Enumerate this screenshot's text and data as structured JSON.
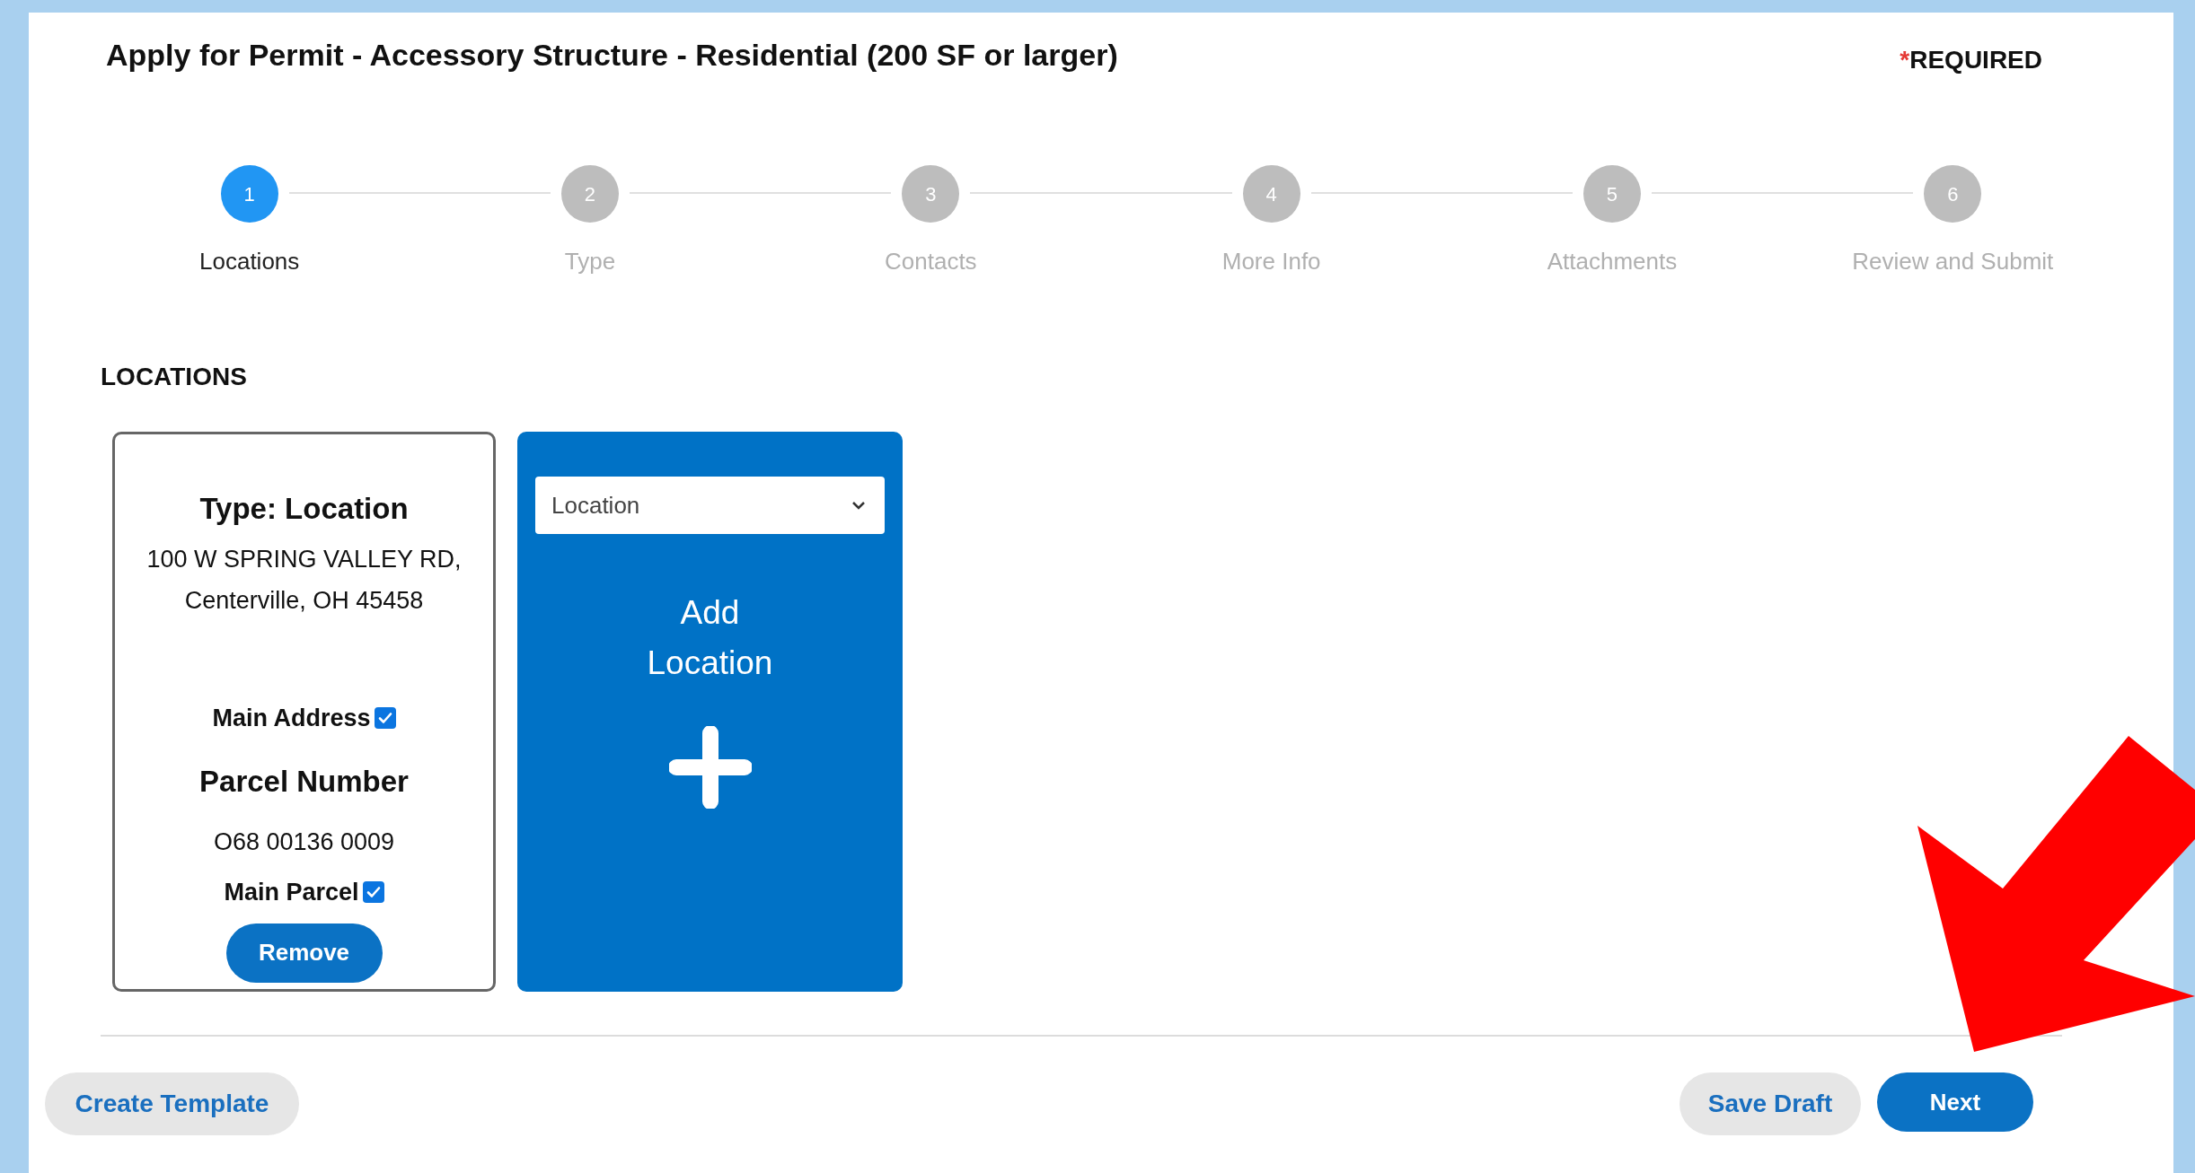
{
  "title": "Apply for Permit - Accessory Structure - Residential (200 SF or larger)",
  "required": {
    "mark": "*",
    "label": "REQUIRED"
  },
  "steps": [
    {
      "number": "1",
      "label": "Locations",
      "selected": true
    },
    {
      "number": "2",
      "label": "Type",
      "selected": false
    },
    {
      "number": "3",
      "label": "Contacts",
      "selected": false
    },
    {
      "number": "4",
      "label": "More Info",
      "selected": false
    },
    {
      "number": "5",
      "label": "Attachments",
      "selected": false
    },
    {
      "number": "6",
      "label": "Review and Submit",
      "selected": false
    }
  ],
  "section_heading": "LOCATIONS",
  "location_card": {
    "type_label": "Type: Location",
    "address_lines": [
      "100 W SPRING VALLEY RD,",
      "Centerville, OH 45458"
    ],
    "main_address": {
      "label": "Main Address",
      "checked": true
    },
    "parcel_heading": "Parcel Number",
    "parcel_number": "O68 00136 0009",
    "main_parcel": {
      "label": "Main Parcel",
      "checked": true
    },
    "remove_button": "Remove"
  },
  "add_card": {
    "select_value": "Location",
    "label": "Add Location"
  },
  "footer": {
    "create_template": "Create Template",
    "save_draft": "Save Draft",
    "next": "Next"
  }
}
